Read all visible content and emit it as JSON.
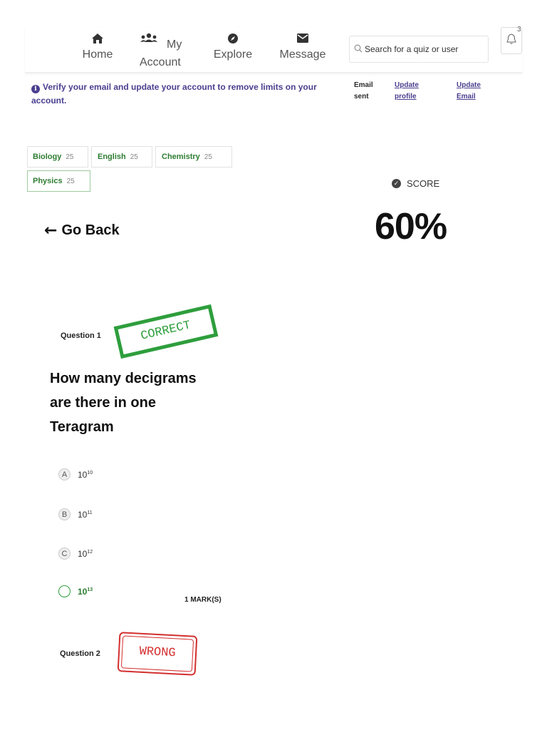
{
  "nav": {
    "home": "Home",
    "my": "My",
    "account": "Account",
    "explore": "Explore",
    "message": "Message",
    "search_placeholder": "Search for a quiz or user",
    "notification_count": "3"
  },
  "verify": {
    "message": "Verify your email and update your account to remove limits on your account.",
    "email_sent": "Email sent",
    "update_profile": "Update profile",
    "update_email": "Update Email"
  },
  "subjects": [
    {
      "name": "Biology",
      "count": "25"
    },
    {
      "name": "English",
      "count": "25"
    },
    {
      "name": "Chemistry",
      "count": "25"
    },
    {
      "name": "Physics",
      "count": "25"
    }
  ],
  "score": {
    "label": "SCORE",
    "value": "60%"
  },
  "go_back": "Go Back",
  "question1": {
    "label": "Question 1",
    "stamp": "CORRECT",
    "text": "How many decigrams are there in one Teragram",
    "options": [
      {
        "letter": "A",
        "base": "10",
        "exp": "10"
      },
      {
        "letter": "B",
        "base": "10",
        "exp": "11"
      },
      {
        "letter": "C",
        "base": "10",
        "exp": "12"
      },
      {
        "letter": "",
        "base": "10",
        "exp": "13"
      }
    ],
    "marks": "1 MARK(S)"
  },
  "question2": {
    "label": "Question 2",
    "stamp": "WRONG"
  },
  "colors": {
    "accent_purple": "#4a3f8f",
    "correct_green": "#2e9e3c",
    "wrong_red": "#d32f2f"
  }
}
